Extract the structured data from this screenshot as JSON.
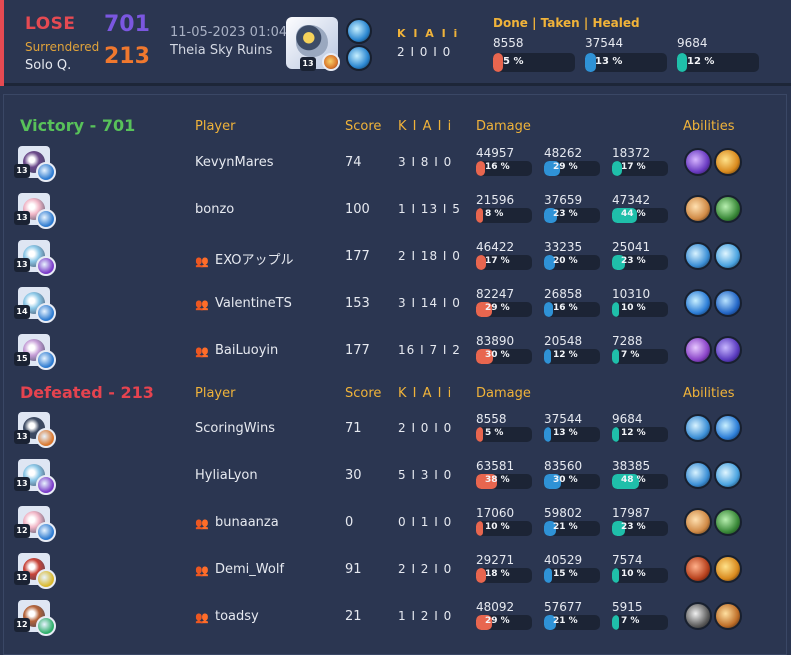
{
  "header": {
    "result": "LOSE",
    "reason": "Surrendered",
    "mode": "Solo Q.",
    "score_blue": "701",
    "score_orange": "213",
    "date": "11-05-2023 01:04",
    "stage": "Theia Sky Ruins",
    "level": "13",
    "kali_title": "K I A I i",
    "kali_value": "2 I 0 I 0",
    "dth_title": "Done | Taken | Healed",
    "stats": [
      {
        "value": "8558",
        "pct": "5 %",
        "fraction": 0.05,
        "color": "red"
      },
      {
        "value": "37544",
        "pct": "13 %",
        "fraction": 0.13,
        "color": "blue"
      },
      {
        "value": "9684",
        "pct": "12 %",
        "fraction": 0.12,
        "color": "teal"
      }
    ],
    "colors": {
      "lose": "#e54a52",
      "blue_team": "#7b57e0",
      "orange_team": "#f0782e",
      "accent": "#f0b33a"
    }
  },
  "columns": {
    "player": "Player",
    "score": "Score",
    "kali": "K I A I i",
    "damage": "Damage",
    "abilities": "Abilities"
  },
  "victory": {
    "title": "Victory - 701",
    "color": "#58c25a",
    "players": [
      {
        "name": "KevynMares",
        "party": false,
        "level": "13",
        "score": "74",
        "kali": "3 I 8 I 0",
        "dmg": [
          {
            "v": "44957",
            "p": "16 %",
            "f": 0.16
          },
          {
            "v": "48262",
            "p": "29 %",
            "f": 0.29
          },
          {
            "v": "18372",
            "p": "17 %",
            "f": 0.17
          }
        ],
        "icons": [
          "pokemon-icon",
          "held-item-icon",
          "ability-icon",
          "ability-icon"
        ]
      },
      {
        "name": "bonzo",
        "party": false,
        "level": "13",
        "score": "100",
        "kali": "1 I 13 I 5",
        "dmg": [
          {
            "v": "21596",
            "p": "8 %",
            "f": 0.08
          },
          {
            "v": "37659",
            "p": "23 %",
            "f": 0.23
          },
          {
            "v": "47342",
            "p": "44 %",
            "f": 0.44
          }
        ],
        "icons": [
          "pokemon-icon",
          "held-item-icon",
          "ability-icon",
          "ability-icon"
        ]
      },
      {
        "name": "EXOアップル",
        "party": true,
        "level": "13",
        "score": "177",
        "kali": "2 I 18 I 0",
        "dmg": [
          {
            "v": "46422",
            "p": "17 %",
            "f": 0.17
          },
          {
            "v": "33235",
            "p": "20 %",
            "f": 0.2
          },
          {
            "v": "25041",
            "p": "23 %",
            "f": 0.23
          }
        ],
        "icons": [
          "pokemon-icon",
          "held-item-icon",
          "ability-icon",
          "ability-icon"
        ]
      },
      {
        "name": "ValentineTS",
        "party": true,
        "level": "14",
        "score": "153",
        "kali": "3 I 14 I 0",
        "dmg": [
          {
            "v": "82247",
            "p": "29 %",
            "f": 0.29
          },
          {
            "v": "26858",
            "p": "16 %",
            "f": 0.16
          },
          {
            "v": "10310",
            "p": "10 %",
            "f": 0.1
          }
        ],
        "icons": [
          "pokemon-icon",
          "held-item-icon",
          "ability-icon",
          "ability-icon"
        ]
      },
      {
        "name": "BaiLuoyin",
        "party": true,
        "level": "15",
        "score": "177",
        "kali": "16 I 7 I 2",
        "dmg": [
          {
            "v": "83890",
            "p": "30 %",
            "f": 0.3
          },
          {
            "v": "20548",
            "p": "12 %",
            "f": 0.12
          },
          {
            "v": "7288",
            "p": "7 %",
            "f": 0.07
          }
        ],
        "icons": [
          "pokemon-icon",
          "held-item-icon",
          "ability-icon",
          "ability-icon"
        ]
      }
    ]
  },
  "defeated": {
    "title": "Defeated - 213",
    "color": "#e5434f",
    "players": [
      {
        "name": "ScoringWins",
        "party": false,
        "level": "13",
        "score": "71",
        "kali": "2 I 0 I 0",
        "dmg": [
          {
            "v": "8558",
            "p": "5 %",
            "f": 0.05
          },
          {
            "v": "37544",
            "p": "13 %",
            "f": 0.13
          },
          {
            "v": "9684",
            "p": "12 %",
            "f": 0.12
          }
        ],
        "icons": [
          "pokemon-icon",
          "held-item-icon",
          "ability-icon",
          "ability-icon"
        ]
      },
      {
        "name": "HyliaLyon",
        "party": false,
        "level": "13",
        "score": "30",
        "kali": "5 I 3 I 0",
        "dmg": [
          {
            "v": "63581",
            "p": "38 %",
            "f": 0.38
          },
          {
            "v": "83560",
            "p": "30 %",
            "f": 0.3
          },
          {
            "v": "38385",
            "p": "48 %",
            "f": 0.48
          }
        ],
        "icons": [
          "pokemon-icon",
          "held-item-icon",
          "ability-icon",
          "ability-icon"
        ]
      },
      {
        "name": "bunaanza",
        "party": true,
        "level": "12",
        "score": "0",
        "kali": "0 I 1 I 0",
        "dmg": [
          {
            "v": "17060",
            "p": "10 %",
            "f": 0.1
          },
          {
            "v": "59802",
            "p": "21 %",
            "f": 0.21
          },
          {
            "v": "17987",
            "p": "23 %",
            "f": 0.23
          }
        ],
        "icons": [
          "pokemon-icon",
          "held-item-icon",
          "ability-icon",
          "ability-icon"
        ]
      },
      {
        "name": "Demi_Wolf",
        "party": true,
        "level": "12",
        "score": "91",
        "kali": "2 I 2 I 0",
        "dmg": [
          {
            "v": "29271",
            "p": "18 %",
            "f": 0.18
          },
          {
            "v": "40529",
            "p": "15 %",
            "f": 0.15
          },
          {
            "v": "7574",
            "p": "10 %",
            "f": 0.1
          }
        ],
        "icons": [
          "pokemon-icon",
          "held-item-icon",
          "ability-icon",
          "ability-icon"
        ]
      },
      {
        "name": "toadsy",
        "party": true,
        "level": "12",
        "score": "21",
        "kali": "1 I 2 I 0",
        "dmg": [
          {
            "v": "48092",
            "p": "29 %",
            "f": 0.29
          },
          {
            "v": "57677",
            "p": "21 %",
            "f": 0.21
          },
          {
            "v": "5915",
            "p": "7 %",
            "f": 0.07
          }
        ],
        "icons": [
          "pokemon-icon",
          "held-item-icon",
          "ability-icon",
          "ability-icon"
        ]
      }
    ]
  }
}
